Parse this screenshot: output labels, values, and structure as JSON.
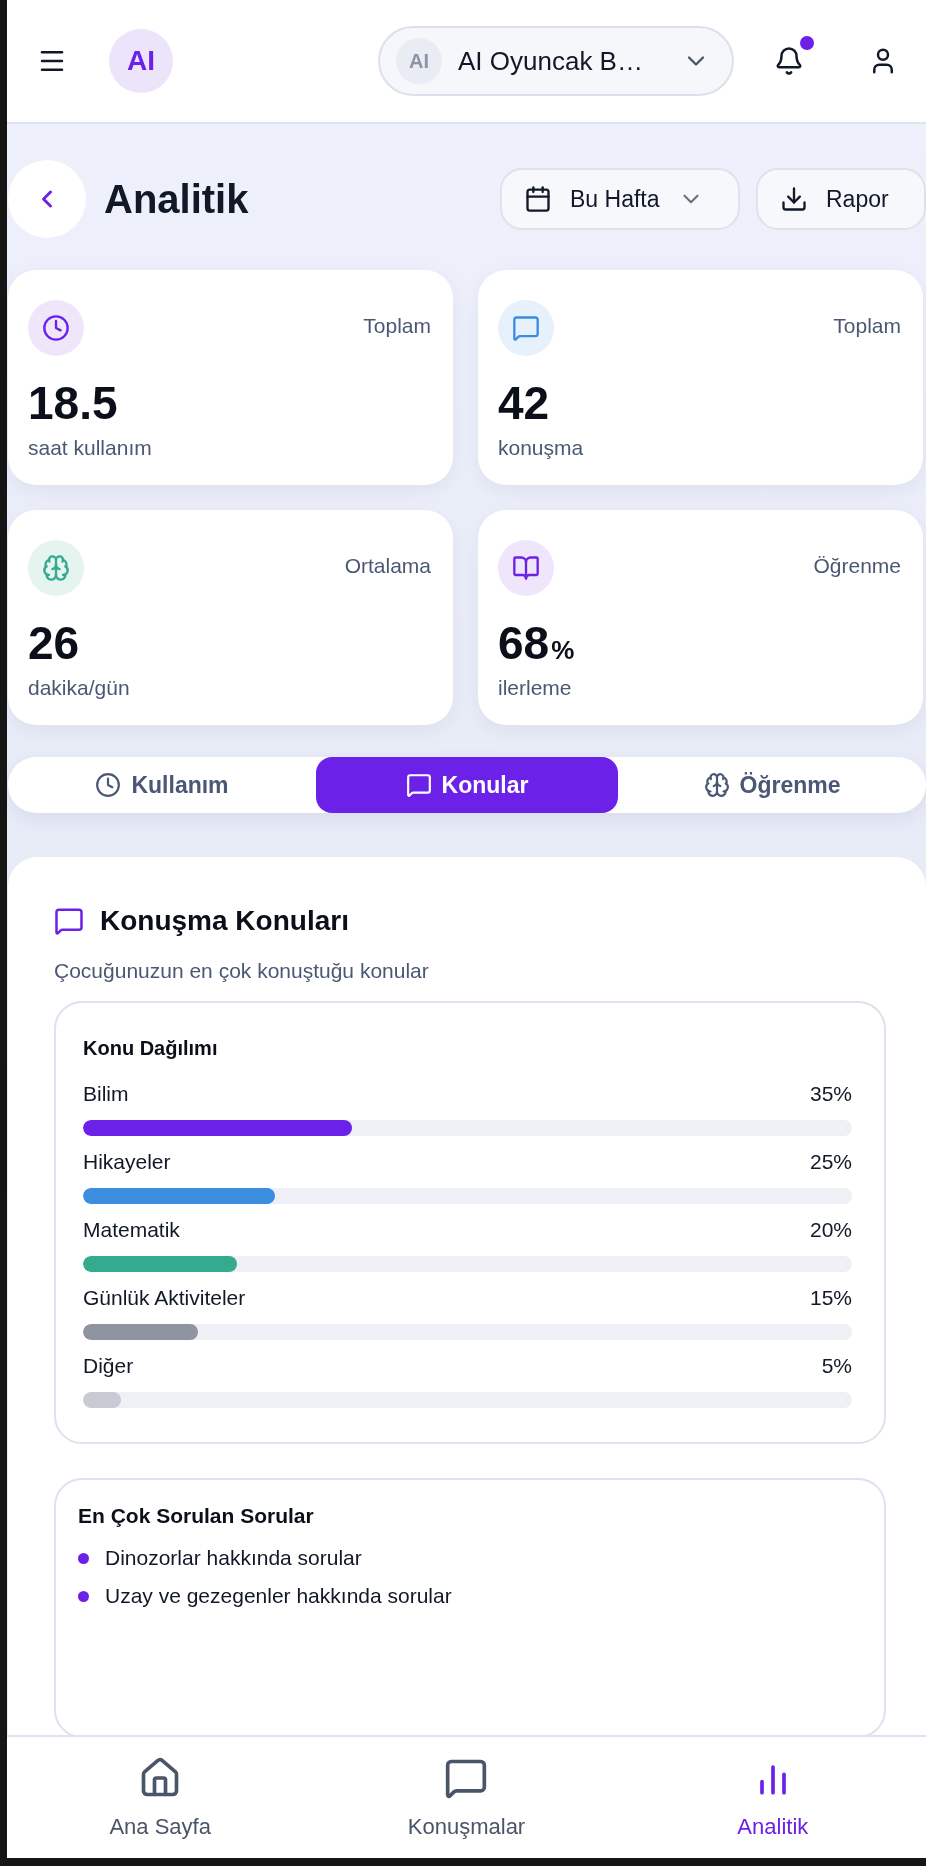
{
  "header": {
    "logo": "AI",
    "device": {
      "avatar": "AI",
      "name": "AI Oyuncak B…"
    },
    "notifications": {
      "unread": true
    }
  },
  "page": {
    "title": "Analitik",
    "period": "Bu Hafta",
    "report": "Rapor"
  },
  "stats": [
    {
      "caption": "Toplam",
      "value": "18.5",
      "label": "saat kullanım"
    },
    {
      "caption": "Toplam",
      "value": "42",
      "label": "konuşma"
    },
    {
      "caption": "Ortalama",
      "value": "26",
      "label": "dakika/gün"
    },
    {
      "caption": "Öğrenme",
      "value": "68",
      "unit": "%",
      "label": "ilerleme"
    }
  ],
  "tabs": [
    {
      "label": "Kullanım",
      "selected": false
    },
    {
      "label": "Konular",
      "selected": true
    },
    {
      "label": "Öğrenme",
      "selected": false
    }
  ],
  "topics": {
    "title": "Konuşma Konuları",
    "subtitle": "Çocuğunuzun en çok konuştuğu konular",
    "distribution": {
      "title": "Konu Dağılımı",
      "items": [
        {
          "label": "Bilim",
          "reading": "35%",
          "level": 0.35,
          "color": "#6b21e8"
        },
        {
          "label": "Hikayeler",
          "reading": "25%",
          "level": 0.25,
          "color": "#3b8de0"
        },
        {
          "label": "Matematik",
          "reading": "20%",
          "level": 0.2,
          "color": "#34ab8e"
        },
        {
          "label": "Günlük Aktiviteler",
          "reading": "15%",
          "level": 0.15,
          "color": "#8e94a0"
        },
        {
          "label": "Diğer",
          "reading": "5%",
          "level": 0.05,
          "color": "#c8cbd3"
        }
      ]
    },
    "questions": {
      "title": "En Çok Sorulan Sorular",
      "items": [
        "Dinozorlar hakkında sorular",
        "Uzay ve gezegenler hakkında sorular"
      ]
    }
  },
  "bottom_nav": [
    {
      "label": "Ana Sayfa",
      "selected": false
    },
    {
      "label": "Konuşmalar",
      "selected": false
    },
    {
      "label": "Analitik",
      "selected": true
    }
  ]
}
